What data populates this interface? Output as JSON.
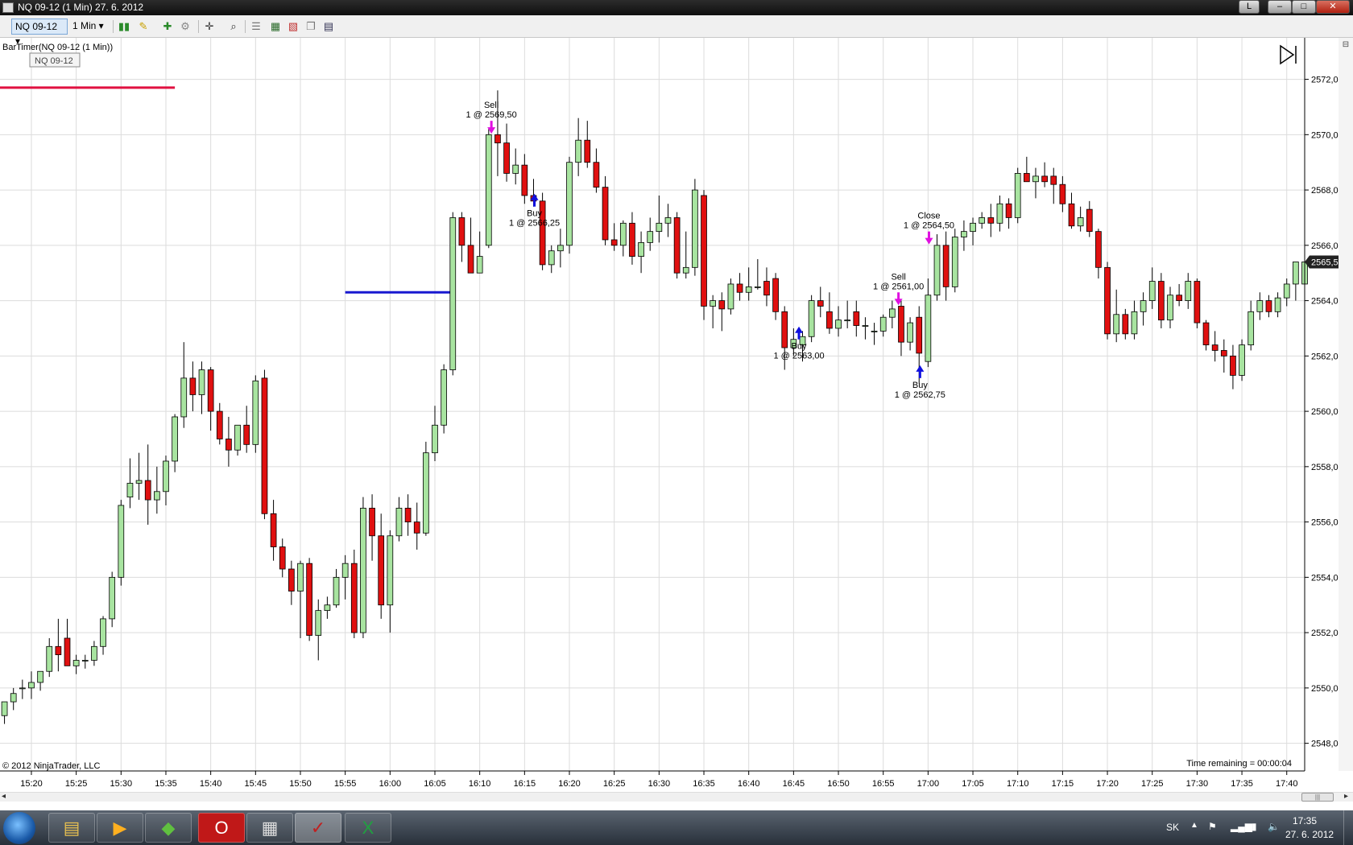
{
  "window": {
    "title": "NQ 09-12 (1 Min)  27. 6. 2012",
    "controls": [
      "L",
      "–",
      "□",
      "✕"
    ]
  },
  "toolbar": {
    "instrument": "NQ 09-12",
    "interval": "1 Min"
  },
  "chart": {
    "indicator_label": "BarTimer(NQ 09-12 (1 Min))",
    "instrument_tooltip": "NQ 09-12",
    "copyright": "© 2012 NinjaTrader, LLC",
    "time_remaining": "Time remaining = 00:00:04",
    "last_price_label": "2565,50"
  },
  "chart_data": {
    "type": "candlestick",
    "title": "NQ 09-12 (1 Min)",
    "ylim": [
      2547,
      2573.5
    ],
    "y_ticks": [
      "2548,00",
      "2550,00",
      "2552,00",
      "2554,00",
      "2556,00",
      "2558,00",
      "2560,00",
      "2562,00",
      "2564,00",
      "2566,00",
      "2568,00",
      "2570,00",
      "2572,00"
    ],
    "y_tick_values": [
      2548,
      2550,
      2552,
      2554,
      2556,
      2558,
      2560,
      2562,
      2564,
      2566,
      2568,
      2570,
      2572
    ],
    "x_ticks": [
      "15:20",
      "15:25",
      "15:30",
      "15:35",
      "15:40",
      "15:45",
      "15:50",
      "15:55",
      "16:00",
      "16:05",
      "16:10",
      "16:15",
      "16:20",
      "16:25",
      "16:30",
      "16:35",
      "16:40",
      "16:45",
      "16:50",
      "16:55",
      "17:00",
      "17:05",
      "17:10",
      "17:15",
      "17:20",
      "17:25",
      "17:30",
      "17:35",
      "17:40"
    ],
    "x_tick_minutes": [
      920,
      925,
      930,
      935,
      940,
      945,
      950,
      955,
      960,
      965,
      970,
      975,
      980,
      985,
      990,
      995,
      1000,
      1005,
      1010,
      1015,
      1020,
      1025,
      1030,
      1035,
      1040,
      1045,
      1050,
      1055,
      1060
    ],
    "xlim_minutes": [
      916.5,
      1062
    ],
    "up_color": "#a8e4a0",
    "down_color": "#e01010",
    "wick_color": "#000000",
    "start_minute": 917,
    "ohlc": [
      [
        2549.0,
        2549.5,
        2548.7,
        2549.5
      ],
      [
        2549.5,
        2550.0,
        2549.2,
        2549.8
      ],
      [
        2550.0,
        2550.3,
        2549.6,
        2550.0
      ],
      [
        2550.0,
        2550.6,
        2549.6,
        2550.2
      ],
      [
        2550.2,
        2550.6,
        2549.9,
        2550.6
      ],
      [
        2550.6,
        2551.8,
        2550.4,
        2551.5
      ],
      [
        2551.5,
        2552.5,
        2550.6,
        2551.2
      ],
      [
        2551.8,
        2552.5,
        2550.8,
        2550.8
      ],
      [
        2550.8,
        2551.2,
        2550.5,
        2551.0
      ],
      [
        2551.0,
        2551.2,
        2550.7,
        2551.0
      ],
      [
        2551.0,
        2551.7,
        2550.8,
        2551.5
      ],
      [
        2551.5,
        2552.6,
        2551.2,
        2552.5
      ],
      [
        2552.5,
        2554.2,
        2552.2,
        2554.0
      ],
      [
        2554.0,
        2556.8,
        2553.7,
        2556.6
      ],
      [
        2556.9,
        2558.3,
        2556.5,
        2557.4
      ],
      [
        2557.4,
        2558.5,
        2556.8,
        2557.5
      ],
      [
        2557.5,
        2558.8,
        2555.9,
        2556.8
      ],
      [
        2556.8,
        2558.0,
        2556.3,
        2557.1
      ],
      [
        2557.1,
        2558.4,
        2556.6,
        2558.2
      ],
      [
        2558.2,
        2559.9,
        2557.8,
        2559.8
      ],
      [
        2559.8,
        2562.5,
        2559.4,
        2561.2
      ],
      [
        2561.2,
        2561.8,
        2560.0,
        2560.6
      ],
      [
        2560.6,
        2561.8,
        2559.9,
        2561.5
      ],
      [
        2561.5,
        2561.6,
        2559.3,
        2560.0
      ],
      [
        2560.0,
        2560.3,
        2558.8,
        2559.0
      ],
      [
        2559.0,
        2559.8,
        2558.0,
        2558.6
      ],
      [
        2558.6,
        2559.5,
        2558.4,
        2559.5
      ],
      [
        2559.5,
        2560.2,
        2558.5,
        2558.8
      ],
      [
        2558.8,
        2561.3,
        2558.5,
        2561.1
      ],
      [
        2561.2,
        2561.5,
        2556.1,
        2556.3
      ],
      [
        2556.3,
        2556.8,
        2554.6,
        2555.1
      ],
      [
        2555.1,
        2555.4,
        2554.0,
        2554.3
      ],
      [
        2554.3,
        2554.6,
        2553.0,
        2553.5
      ],
      [
        2553.5,
        2554.6,
        2551.8,
        2554.5
      ],
      [
        2554.5,
        2554.7,
        2551.7,
        2551.9
      ],
      [
        2551.9,
        2553.2,
        2551.0,
        2552.8
      ],
      [
        2552.8,
        2553.3,
        2552.5,
        2553.0
      ],
      [
        2553.0,
        2554.3,
        2552.9,
        2554.0
      ],
      [
        2554.0,
        2554.8,
        2553.2,
        2554.5
      ],
      [
        2554.5,
        2555.0,
        2551.8,
        2552.0
      ],
      [
        2552.0,
        2556.9,
        2551.8,
        2556.5
      ],
      [
        2556.5,
        2557.0,
        2554.6,
        2555.5
      ],
      [
        2555.5,
        2556.3,
        2552.5,
        2553.0
      ],
      [
        2553.0,
        2555.7,
        2552.0,
        2555.5
      ],
      [
        2555.5,
        2556.9,
        2555.3,
        2556.5
      ],
      [
        2556.5,
        2557.0,
        2555.5,
        2556.0
      ],
      [
        2556.0,
        2556.7,
        2555.0,
        2555.6
      ],
      [
        2555.6,
        2558.9,
        2555.5,
        2558.5
      ],
      [
        2558.5,
        2560.2,
        2558.2,
        2559.5
      ],
      [
        2559.5,
        2561.7,
        2559.2,
        2561.5
      ],
      [
        2561.5,
        2567.2,
        2561.3,
        2567.0
      ],
      [
        2567.0,
        2567.2,
        2565.4,
        2566.0
      ],
      [
        2566.0,
        2567.0,
        2565.4,
        2565.0
      ],
      [
        2565.0,
        2566.5,
        2565.0,
        2565.6
      ],
      [
        2566.0,
        2570.2,
        2565.9,
        2570.0
      ],
      [
        2570.0,
        2571.6,
        2568.5,
        2569.7
      ],
      [
        2569.7,
        2570.4,
        2568.3,
        2568.6
      ],
      [
        2568.6,
        2569.5,
        2568.2,
        2568.9
      ],
      [
        2568.9,
        2569.3,
        2567.5,
        2567.8
      ],
      [
        2567.8,
        2568.4,
        2567.4,
        2567.6
      ],
      [
        2567.6,
        2567.9,
        2565.1,
        2565.3
      ],
      [
        2565.3,
        2566.0,
        2565.0,
        2565.8
      ],
      [
        2565.8,
        2566.6,
        2565.2,
        2566.0
      ],
      [
        2566.0,
        2569.2,
        2565.7,
        2569.0
      ],
      [
        2569.0,
        2570.6,
        2568.5,
        2569.8
      ],
      [
        2569.8,
        2570.5,
        2568.8,
        2569.0
      ],
      [
        2569.0,
        2569.5,
        2567.9,
        2568.1
      ],
      [
        2568.1,
        2568.5,
        2566.0,
        2566.2
      ],
      [
        2566.2,
        2566.8,
        2565.8,
        2566.0
      ],
      [
        2566.0,
        2566.9,
        2565.6,
        2566.8
      ],
      [
        2566.8,
        2567.2,
        2565.3,
        2565.6
      ],
      [
        2565.6,
        2566.5,
        2565.0,
        2566.1
      ],
      [
        2566.1,
        2567.0,
        2565.8,
        2566.5
      ],
      [
        2566.5,
        2567.8,
        2566.1,
        2566.8
      ],
      [
        2566.8,
        2567.5,
        2566.3,
        2567.0
      ],
      [
        2567.0,
        2567.2,
        2564.8,
        2565.0
      ],
      [
        2565.0,
        2566.5,
        2564.8,
        2565.2
      ],
      [
        2565.2,
        2568.4,
        2564.9,
        2568.0
      ],
      [
        2567.8,
        2568.0,
        2563.3,
        2563.8
      ],
      [
        2563.8,
        2564.2,
        2563.0,
        2564.0
      ],
      [
        2564.0,
        2564.3,
        2562.9,
        2563.7
      ],
      [
        2563.7,
        2564.8,
        2563.5,
        2564.6
      ],
      [
        2564.6,
        2565.0,
        2564.0,
        2564.3
      ],
      [
        2564.3,
        2565.2,
        2564.0,
        2564.5
      ],
      [
        2564.5,
        2565.5,
        2564.4,
        2564.5
      ],
      [
        2564.7,
        2565.2,
        2563.8,
        2564.2
      ],
      [
        2564.8,
        2565.0,
        2563.3,
        2563.6
      ],
      [
        2563.6,
        2563.8,
        2561.5,
        2562.3
      ],
      [
        2562.3,
        2563.0,
        2562.0,
        2562.6
      ],
      [
        2562.4,
        2562.9,
        2561.8,
        2562.7
      ],
      [
        2562.7,
        2564.2,
        2562.5,
        2564.0
      ],
      [
        2564.0,
        2564.5,
        2563.4,
        2563.8
      ],
      [
        2563.6,
        2564.3,
        2562.8,
        2563.0
      ],
      [
        2563.0,
        2563.8,
        2562.7,
        2563.3
      ],
      [
        2563.3,
        2564.0,
        2563.0,
        2563.3
      ],
      [
        2563.6,
        2564.0,
        2562.7,
        2563.1
      ],
      [
        2563.1,
        2563.4,
        2562.6,
        2563.1
      ],
      [
        2562.9,
        2563.2,
        2562.4,
        2562.9
      ],
      [
        2562.9,
        2563.5,
        2562.7,
        2563.4
      ],
      [
        2563.4,
        2564.0,
        2563.0,
        2563.7
      ],
      [
        2563.8,
        2564.0,
        2562.0,
        2562.5
      ],
      [
        2562.5,
        2563.4,
        2562.2,
        2563.2
      ],
      [
        2563.4,
        2563.8,
        2561.0,
        2562.1
      ],
      [
        2561.8,
        2564.8,
        2561.6,
        2564.2
      ],
      [
        2564.2,
        2566.4,
        2564.0,
        2566.0
      ],
      [
        2566.0,
        2566.5,
        2564.0,
        2564.5
      ],
      [
        2564.5,
        2566.6,
        2564.3,
        2566.3
      ],
      [
        2566.3,
        2566.9,
        2565.8,
        2566.5
      ],
      [
        2566.5,
        2567.0,
        2566.0,
        2566.8
      ],
      [
        2566.8,
        2567.2,
        2566.6,
        2567.0
      ],
      [
        2567.0,
        2567.5,
        2566.3,
        2566.8
      ],
      [
        2566.8,
        2567.8,
        2566.5,
        2567.5
      ],
      [
        2567.5,
        2567.7,
        2566.6,
        2567.0
      ],
      [
        2567.0,
        2568.8,
        2566.8,
        2568.6
      ],
      [
        2568.6,
        2569.2,
        2568.3,
        2568.3
      ],
      [
        2568.3,
        2568.8,
        2567.7,
        2568.5
      ],
      [
        2568.5,
        2569.0,
        2568.1,
        2568.3
      ],
      [
        2568.5,
        2568.8,
        2567.5,
        2568.2
      ],
      [
        2568.2,
        2568.5,
        2567.2,
        2567.5
      ],
      [
        2567.5,
        2567.9,
        2566.6,
        2566.7
      ],
      [
        2566.7,
        2567.4,
        2566.5,
        2567.0
      ],
      [
        2567.3,
        2567.6,
        2566.3,
        2566.5
      ],
      [
        2566.5,
        2566.6,
        2564.8,
        2565.2
      ],
      [
        2565.2,
        2565.4,
        2562.6,
        2562.8
      ],
      [
        2562.8,
        2564.4,
        2562.5,
        2563.5
      ],
      [
        2563.5,
        2563.7,
        2562.6,
        2562.8
      ],
      [
        2562.8,
        2564.0,
        2562.6,
        2563.6
      ],
      [
        2563.6,
        2564.3,
        2563.1,
        2564.0
      ],
      [
        2564.0,
        2565.2,
        2563.7,
        2564.7
      ],
      [
        2564.7,
        2565.0,
        2563.0,
        2563.3
      ],
      [
        2563.3,
        2564.5,
        2563.0,
        2564.2
      ],
      [
        2564.2,
        2564.6,
        2563.8,
        2564.0
      ],
      [
        2564.0,
        2565.0,
        2563.7,
        2564.7
      ],
      [
        2564.7,
        2564.8,
        2563.0,
        2563.2
      ],
      [
        2563.2,
        2563.3,
        2562.2,
        2562.4
      ],
      [
        2562.4,
        2562.9,
        2561.8,
        2562.2
      ],
      [
        2562.2,
        2562.6,
        2561.4,
        2562.0
      ],
      [
        2562.0,
        2562.4,
        2560.8,
        2561.3
      ],
      [
        2561.3,
        2562.6,
        2561.1,
        2562.4
      ],
      [
        2562.4,
        2564.0,
        2562.2,
        2563.6
      ],
      [
        2563.6,
        2564.3,
        2563.3,
        2564.0
      ],
      [
        2564.0,
        2564.2,
        2563.4,
        2563.6
      ],
      [
        2563.6,
        2564.3,
        2563.4,
        2564.1
      ],
      [
        2564.1,
        2564.8,
        2563.8,
        2564.6
      ],
      [
        2564.6,
        2565.4,
        2564.0,
        2565.4
      ],
      [
        2564.6,
        2566.0,
        2564.6,
        2565.4
      ]
    ],
    "horizontal_lines": [
      {
        "y": 2571.7,
        "x_from": 919.0,
        "x_to": 923.2,
        "color": "#e01040"
      },
      {
        "y": 2564.3,
        "x_from": 927.0,
        "x_to": 929.4,
        "color": "#1818d0"
      },
      {
        "y": 2568.0,
        "x_from": 952.4,
        "x_to": 955.8,
        "color": "#1818d0"
      },
      {
        "y": 2560.9,
        "x_from": 952.0,
        "x_to": 955.8,
        "color": "#e01040"
      }
    ],
    "executions": [
      {
        "side": "Sell",
        "label": "1 @ 2569,50",
        "minute": 971.3,
        "price": 2570.5
      },
      {
        "side": "Buy",
        "label": "1 @ 2566,25",
        "minute": 976.1,
        "price": 2567.4
      },
      {
        "side": "Buy",
        "label": "1 @ 2563,00",
        "minute": 1005.6,
        "price": 2562.6
      },
      {
        "side": "Sell",
        "label": "1 @ 2561,00",
        "minute": 1016.7,
        "price": 2564.3
      },
      {
        "side": "Buy",
        "label": "1 @ 2562,75",
        "minute": 1019.1,
        "price": 2561.2
      },
      {
        "side": "Close",
        "label": "1 @ 2564,50",
        "minute": 1020.1,
        "price": 2566.5
      }
    ]
  },
  "taskbar": {
    "apps": [
      "start-orb",
      "file-explorer",
      "media-player",
      "book-app",
      "opera-browser",
      "calculator",
      "ninjatrader",
      "excel"
    ],
    "language": "SK",
    "clock_time": "17:35",
    "clock_date": "27. 6. 2012"
  }
}
